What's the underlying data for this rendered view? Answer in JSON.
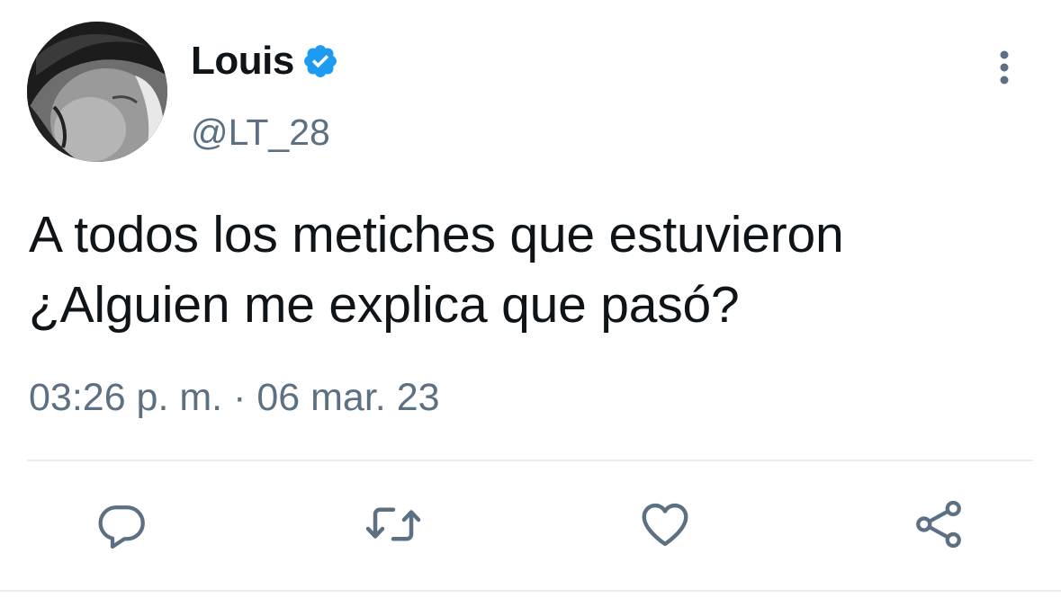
{
  "tweet": {
    "display_name": "Louis",
    "handle": "@LT_28",
    "text_lines": [
      "A todos los metiches que estuvieron",
      "¿Alguien me explica que pasó?"
    ],
    "timestamp": "03:26 p. m. · 06 mar. 23",
    "verified": true
  },
  "icons": {
    "verified": "verified-badge-icon",
    "more": "more-vertical-icon",
    "reply": "reply-icon",
    "retweet": "retweet-icon",
    "like": "heart-icon",
    "share": "share-icon"
  },
  "colors": {
    "text": "#0f1419",
    "secondary": "#5b7083",
    "verified": "#1d9bf0",
    "divider": "#e6ecf0"
  }
}
